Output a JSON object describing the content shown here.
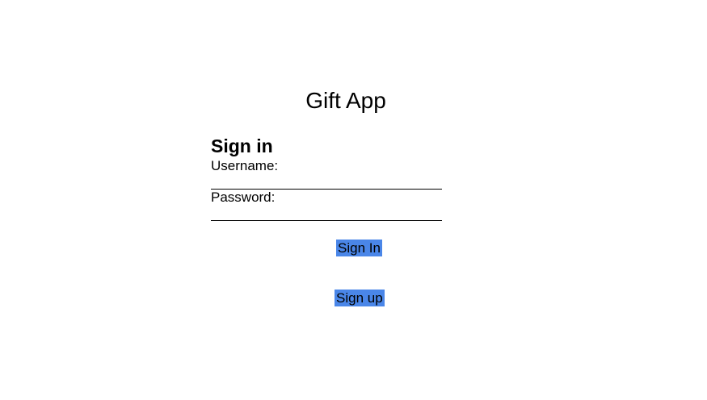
{
  "app": {
    "title": "Gift App"
  },
  "signin_form": {
    "heading": "Sign in",
    "username_label": "Username:",
    "username_value": "",
    "password_label": "Password:",
    "password_value": "",
    "signin_button_label": "Sign In",
    "signup_button_label": "Sign up"
  },
  "colors": {
    "button_background": "#4a86e8",
    "background": "#ffffff",
    "text": "#000000"
  }
}
